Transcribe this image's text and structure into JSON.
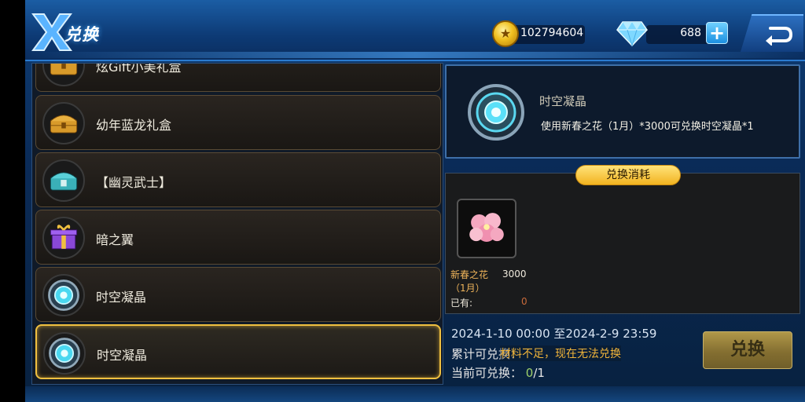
{
  "header": {
    "title": "兑换",
    "gold": "102794604",
    "diamonds": "688",
    "plus_label": "+"
  },
  "colors": {
    "selected_border": "#f0c040",
    "warn": "#f0b43a",
    "accent_blue": "#2a7bd0"
  },
  "list": {
    "items": [
      {
        "name": "炫Gift小美礼盒",
        "icon": "gold-chest-icon"
      },
      {
        "name": "幼年蓝龙礼盒",
        "icon": "gold-chest-icon"
      },
      {
        "name": "【幽灵武士】",
        "icon": "teal-chest-icon"
      },
      {
        "name": "暗之翼",
        "icon": "purple-giftbox-icon"
      },
      {
        "name": "时空凝晶",
        "icon": "crystal-orb-icon"
      },
      {
        "name": "时空凝晶",
        "icon": "crystal-orb-icon",
        "selected": true
      }
    ]
  },
  "detail": {
    "name": "时空凝晶",
    "description": "使用新春之花（1月）*3000可兑换时空凝晶*1"
  },
  "cost": {
    "tab_label": "兑换消耗",
    "material_name": "新春之花（1月）",
    "material_need": "3000",
    "have_label": "已有:",
    "have_value": "0"
  },
  "footer": {
    "date_range": "2024-1-10 00:00 至2024-2-9 23:59",
    "total_label": "累计可兑换：",
    "warning": "材料不足，现在无法兑换",
    "current_label": "当前可兑换：",
    "current_value": "0",
    "current_max": "/1",
    "exchange_button": "兑换"
  }
}
